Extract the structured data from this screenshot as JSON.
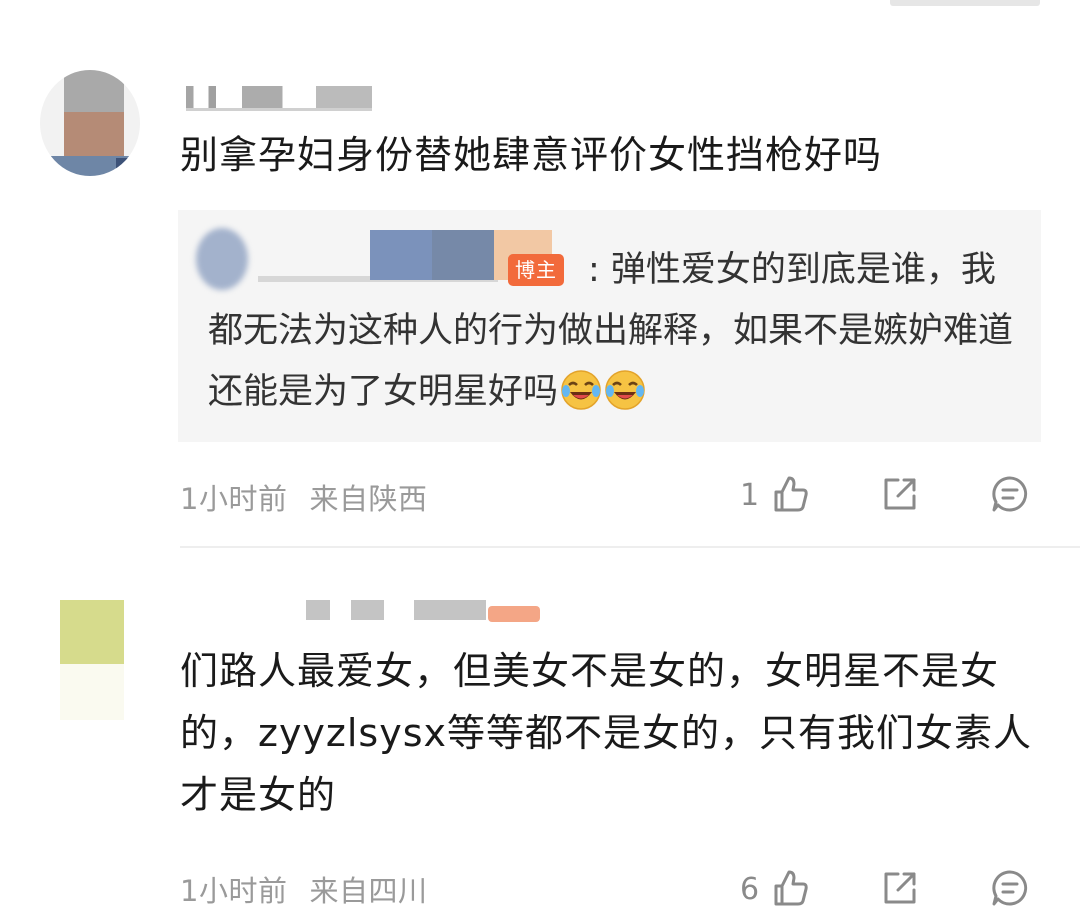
{
  "comments": [
    {
      "text": "别拿孕妇身份替她肆意评价女性挡枪好吗",
      "reply": {
        "badge": "博主",
        "text": ": 弹性爱女的到底是谁，我都无法为这种人的行为做出解释，如果不是嫉妒难道还能是为了女明星好吗",
        "emoji": [
          "laugh-cry",
          "laugh-cry"
        ]
      },
      "time": "1小时前",
      "location": "来自陕西",
      "likes": "1"
    },
    {
      "text": "们路人最爱女，但美女不是女的，女明星不是女的，zyyzlsysx等等都不是女的，只有我们女素人才是女的",
      "time": "1小时前",
      "location": "来自四川",
      "likes": "6"
    }
  ],
  "icons": {
    "like": "thumbs-up-icon",
    "share": "share-icon",
    "comment": "comment-bubble-icon"
  },
  "colors": {
    "badge": "#f26a3b",
    "meta": "#9a9a9a",
    "reply_bg": "#f5f5f5"
  }
}
